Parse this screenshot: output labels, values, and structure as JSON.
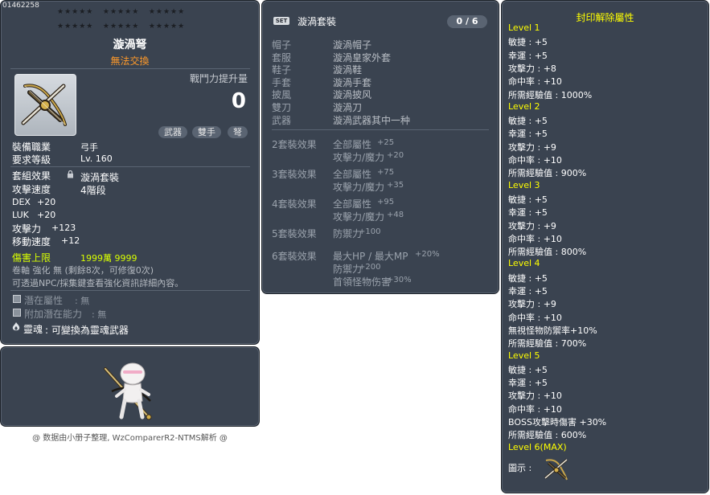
{
  "item": {
    "code": "01462258",
    "name": "漩渦弩",
    "trade": "無法交換",
    "cp_label": "戰鬥力提升量",
    "cp_value": "0",
    "tags": [
      "武器",
      "雙手",
      "弩"
    ],
    "job_label": "裝備職業",
    "job_value": "弓手",
    "level_label": "要求等級",
    "level_value": "Lv. 160",
    "set_label": "套組效果",
    "set_value": "漩渦套裝",
    "speed_label": "攻擊速度",
    "speed_value": "4階段",
    "stats": [
      {
        "name": "DEX",
        "value": "+20"
      },
      {
        "name": "LUK",
        "value": "+20"
      },
      {
        "name": "攻擊力",
        "value": "+123"
      },
      {
        "name": "移動速度",
        "value": "+12"
      }
    ],
    "dmg_cap_label": "傷害上限",
    "dmg_cap_value": "1999萬 9999",
    "scroll_line": "卷軸 強化 無 (剩餘8次，可修復0次)",
    "npc_line": "可透過NPC/採集鍵查看強化資訊詳細內容。",
    "potential_label": "潛在屬性",
    "potential_value": ": 無",
    "add_potential_label": "附加潛在能力",
    "add_potential_value": ": 無",
    "soul_label": "靈魂",
    "soul_value": ": 可變換為靈魂武器"
  },
  "footer": "@ 数据由小册子整理, WzComparerR2-NTMS解析 @",
  "set": {
    "badge": "SET",
    "name": "漩渦套裝",
    "counter": "0 / 6",
    "parts": [
      {
        "slot": "帽子",
        "name": "漩渦帽子"
      },
      {
        "slot": "套服",
        "name": "漩渦皇家外套"
      },
      {
        "slot": "鞋子",
        "name": "漩渦鞋"
      },
      {
        "slot": "手套",
        "name": "漩渦手套"
      },
      {
        "slot": "披風",
        "name": "漩渦披风"
      },
      {
        "slot": "雙刀",
        "name": "漩渦刀"
      },
      {
        "slot": "武器",
        "name": "漩渦武器其中一种"
      }
    ],
    "effects": [
      {
        "label": "2套裝效果",
        "lines": [
          [
            "全部屬性",
            "+25"
          ],
          [
            "攻擊力/魔力",
            "+20"
          ]
        ]
      },
      {
        "label": "3套裝效果",
        "lines": [
          [
            "全部屬性",
            "+75"
          ],
          [
            "攻擊力/魔力",
            "+35"
          ]
        ]
      },
      {
        "label": "4套裝效果",
        "lines": [
          [
            "全部屬性",
            "+95"
          ],
          [
            "攻擊力/魔力",
            "+48"
          ]
        ]
      },
      {
        "label": "5套裝效果",
        "lines": [
          [
            "防禦力",
            "+100"
          ]
        ]
      },
      {
        "label": "6套裝效果",
        "lines": [
          [
            "最大HP / 最大MP",
            "+20%"
          ],
          [
            "防禦力",
            "+200"
          ],
          [
            "首領怪物伤害",
            "+30%"
          ]
        ]
      }
    ]
  },
  "seal": {
    "title": "封印解除屬性",
    "levels": [
      {
        "name": "Level 1",
        "lines": [
          "敏捷 : +5",
          "幸運 : +5",
          "攻擊力 : +8",
          "命中率 : +10",
          "所需經驗值 : 1000%"
        ]
      },
      {
        "name": "Level 2",
        "lines": [
          "敏捷 : +5",
          "幸運 : +5",
          "攻擊力 : +9",
          "命中率 : +10",
          "所需經驗值 : 900%"
        ]
      },
      {
        "name": "Level 3",
        "lines": [
          "敏捷 : +5",
          "幸運 : +5",
          "攻擊力 : +9",
          "命中率 : +10",
          "所需經驗值 : 800%"
        ]
      },
      {
        "name": "Level 4",
        "lines": [
          "敏捷 : +5",
          "幸運 : +5",
          "攻擊力 : +9",
          "命中率 : +10",
          "無視怪物防禦率+10%",
          "所需經驗值 : 700%"
        ]
      },
      {
        "name": "Level 5",
        "lines": [
          "敏捷 : +5",
          "幸運 : +5",
          "攻擊力 : +10",
          "命中率 : +10",
          "BOSS攻擊時傷害 +30%",
          "所需經驗值 : 600%"
        ]
      },
      {
        "name": "Level 6(MAX)",
        "lines": []
      }
    ],
    "icon_label": "圖示 :"
  },
  "icons": {
    "weapon": "crossbow-icon",
    "character": "character-sprite",
    "soul": "flame-icon",
    "gem": "gem-socket-icon",
    "lock": "lock-icon"
  }
}
